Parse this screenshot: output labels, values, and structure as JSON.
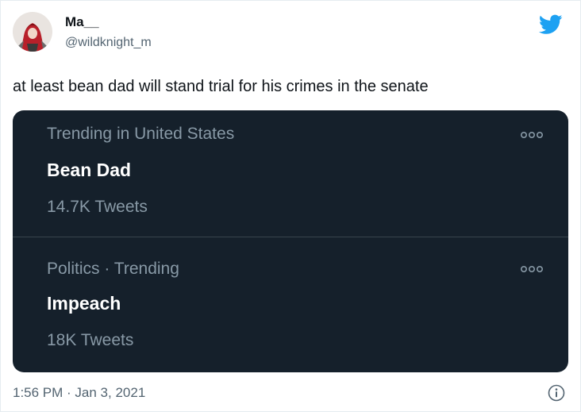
{
  "author": {
    "display_name": "Ma__",
    "handle": "@wildknight_m"
  },
  "brand_icon": "twitter-bird-icon",
  "tweet": {
    "text": "at least bean dad will stand trial for his crimes in the senate",
    "timestamp": "1:56 PM · Jan 3, 2021"
  },
  "trends": [
    {
      "context": "Trending in United States",
      "title": "Bean Dad",
      "count": "14.7K Tweets"
    },
    {
      "context": "Politics · Trending",
      "title": "Impeach",
      "count": "18K Tweets"
    }
  ],
  "colors": {
    "brand_blue": "#1da1f2",
    "card_background": "#15202b",
    "muted_text": "#8899a6"
  }
}
